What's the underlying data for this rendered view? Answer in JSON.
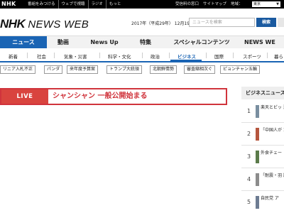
{
  "topbar": {
    "logo": "NHK",
    "links": [
      "番組をみつける",
      "ウェブで視聴",
      "ラジオ",
      "もっと"
    ],
    "right_links": [
      "受信料の窓口",
      "サイトマップ",
      "地域："
    ],
    "region": "東京"
  },
  "header": {
    "brand_nhk": "NHK",
    "brand_news": "NEWS WEB",
    "date": "2017年（平成29年） 12月19日 火曜日",
    "search_placeholder": "ニュースを検索",
    "search_button": "検索"
  },
  "main_nav": [
    {
      "label": "ニュース",
      "active": true
    },
    {
      "label": "動画",
      "active": false
    },
    {
      "label": "News Up",
      "active": false
    },
    {
      "label": "特集",
      "active": false
    },
    {
      "label": "スペシャルコンテンツ",
      "active": false
    },
    {
      "label": "NEWS WE",
      "active": false
    }
  ],
  "sub_nav": [
    {
      "label": "新着",
      "active": false
    },
    {
      "label": "社会",
      "active": false
    },
    {
      "label": "気象・災害",
      "active": false
    },
    {
      "label": "科学・文化",
      "active": false
    },
    {
      "label": "政治",
      "active": false
    },
    {
      "label": "ビジネス",
      "active": true
    },
    {
      "label": "国際",
      "active": false
    },
    {
      "label": "スポーツ",
      "active": false
    },
    {
      "label": "暮ら",
      "active": false
    }
  ],
  "tags": [
    "リニア入札不正",
    "パンダ",
    "来年度予算案",
    "トランプ大統領",
    "北朝鮮情勢",
    "審査縮相次ぐ",
    "ピョンチャン五輪"
  ],
  "live": {
    "badge": "LIVE",
    "title": "シャンシャン 一般公開始まる"
  },
  "ranking": {
    "heading": "ビジネスニュース",
    "items": [
      {
        "num": "1",
        "text": "楽天とビッ 通販事業へ",
        "color": "#7a8fa0"
      },
      {
        "num": "2",
        "text": "「中国人が 1位に Ｊ日",
        "color": "#b5563e"
      },
      {
        "num": "3",
        "text": "外食チェー 「大戸屋」",
        "color": "#5b7b4a"
      },
      {
        "num": "4",
        "text": "「耐震・羽 議会員",
        "color": "#8c8c8c"
      },
      {
        "num": "5",
        "text": "自民党 ア",
        "color": "#6d7c92"
      }
    ]
  }
}
